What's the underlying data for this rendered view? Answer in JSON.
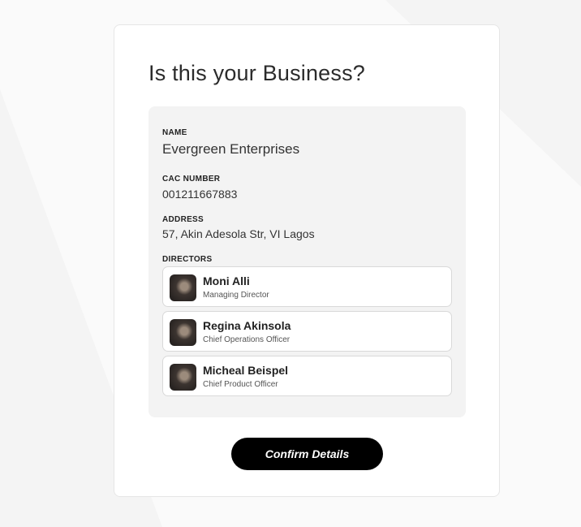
{
  "page": {
    "title": "Is this your Business?"
  },
  "business": {
    "name_label": "NAME",
    "name_value": "Evergreen Enterprises",
    "cac_label": "CAC NUMBER",
    "cac_value": "001211667883",
    "address_label": "ADDRESS",
    "address_value": "57, Akin Adesola Str, VI Lagos",
    "directors_label": "DIRECTORS"
  },
  "directors": [
    {
      "name": "Moni Alli",
      "role": "Managing Director"
    },
    {
      "name": "Regina Akinsola",
      "role": "Chief Operations Officer"
    },
    {
      "name": "Micheal Beispel",
      "role": "Chief Product Officer"
    }
  ],
  "actions": {
    "confirm_label": "Confirm Details"
  }
}
